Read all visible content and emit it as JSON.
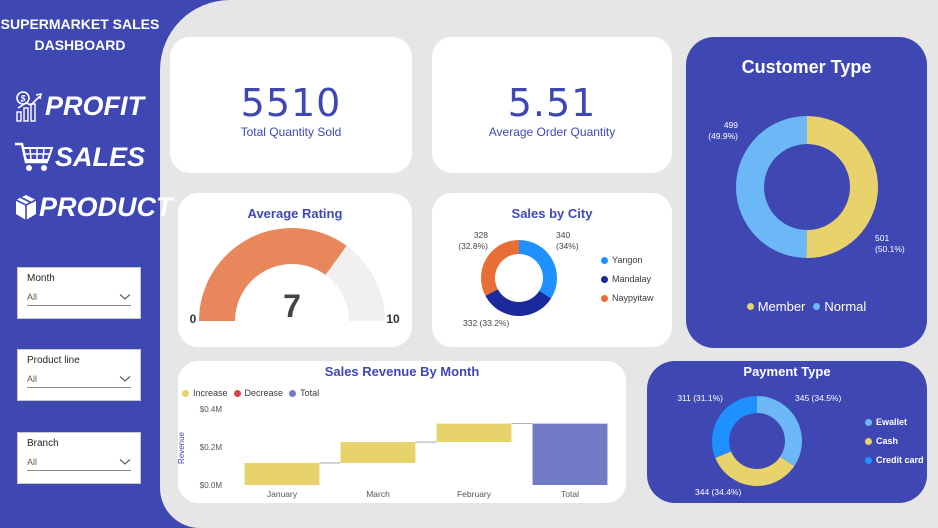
{
  "sidebar": {
    "title_line1": "SUPERMARKET SALES",
    "title_line2": "DASHBOARD",
    "nav": [
      {
        "label": "PROFIT",
        "icon": "profit-icon"
      },
      {
        "label": "SALES",
        "icon": "cart-icon"
      },
      {
        "label": "PRODUCT",
        "icon": "box-icon"
      }
    ],
    "slicers": [
      {
        "label": "Month",
        "value": "All"
      },
      {
        "label": "Product line",
        "value": "All"
      },
      {
        "label": "Branch",
        "value": "All"
      }
    ]
  },
  "kpis": {
    "total_quantity": {
      "value": "5510",
      "label": "Total Quantity Sold"
    },
    "avg_order_qty": {
      "value": "5.51",
      "label": "Average Order Quantity"
    }
  },
  "rating": {
    "title": "Average Rating",
    "value": "7",
    "min_label": "0",
    "max_label": "10"
  },
  "city": {
    "title": "Sales by City"
  },
  "customer": {
    "title": "Customer Type"
  },
  "revenue": {
    "title": "Sales Revenue By Month"
  },
  "payment": {
    "title": "Payment Type"
  },
  "colors": {
    "brand": "#3f48b2",
    "gauge_fill": "#e8875c",
    "gauge_track": "#f1f0ef",
    "yangon": "#1e90ff",
    "mandalay": "#1a2a9c",
    "naypyitaw": "#e76f35",
    "member": "#e8d26b",
    "normal": "#6cb8f6",
    "increase": "#e8d26b",
    "decrease": "#d9434f",
    "total": "#737bc7"
  },
  "chart_data": [
    {
      "type": "gauge",
      "title": "Average Rating",
      "value": 7,
      "min": 0,
      "max": 10
    },
    {
      "type": "pie",
      "title": "Sales by City",
      "donut": true,
      "categories": [
        "Yangon",
        "Mandalay",
        "Naypyitaw"
      ],
      "values": [
        340,
        332,
        328
      ],
      "labels": [
        [
          "340",
          "(34%)"
        ],
        [
          "332 (33.2%)"
        ],
        [
          "328",
          "(32.8%)"
        ]
      ],
      "legend": "right"
    },
    {
      "type": "pie",
      "title": "Customer Type",
      "donut": true,
      "categories": [
        "Member",
        "Normal"
      ],
      "values": [
        501,
        499
      ],
      "labels": [
        [
          "501",
          "(50.1%)"
        ],
        [
          "499",
          "(49.9%)"
        ]
      ],
      "legend": "bottom"
    },
    {
      "type": "bar",
      "subtype": "waterfall",
      "title": "Sales Revenue By Month",
      "ylabel": "Revenue",
      "legend_labels": [
        "Increase",
        "Decrease",
        "Total"
      ],
      "categories": [
        "January",
        "March",
        "February",
        "Total"
      ],
      "values": [
        0.116,
        0.11,
        0.097,
        0.323
      ],
      "value_unit": "M",
      "ylim": [
        0,
        0.4
      ],
      "y_ticks": [
        "$0.0M",
        "$0.2M",
        "$0.4M"
      ],
      "grid": false
    },
    {
      "type": "pie",
      "title": "Payment Type",
      "donut": true,
      "categories": [
        "Ewallet",
        "Cash",
        "Credit card"
      ],
      "values": [
        345,
        344,
        311
      ],
      "labels": [
        "345 (34.5%)",
        "344 (34.4%)",
        "311 (31.1%)"
      ],
      "colors": [
        "#6cb8f6",
        "#e8d26b",
        "#1e90ff"
      ],
      "legend": "right"
    }
  ]
}
